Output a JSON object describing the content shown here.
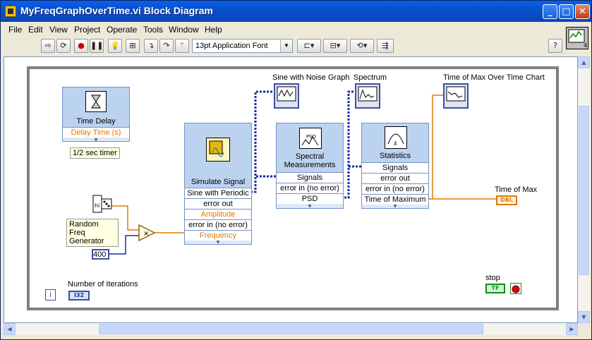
{
  "window": {
    "title": "MyFreqGraphOverTime.vi Block Diagram"
  },
  "menu": [
    "File",
    "Edit",
    "View",
    "Project",
    "Operate",
    "Tools",
    "Window",
    "Help"
  ],
  "toolbar": {
    "font": "13pt Application Font"
  },
  "nodes": {
    "time_delay": {
      "title": "Time Delay",
      "terminal": "Delay Time (s)",
      "comment": "1/2 sec timer"
    },
    "simulate_signal": {
      "title": "Simulate Signal",
      "terminals": [
        "Sine with Periodic",
        "error out",
        "Amplitude",
        "error in (no error)",
        "Frequency"
      ]
    },
    "spectral": {
      "title": "Spectral Measurements",
      "terminals": [
        "Signals",
        "error in (no error)",
        "PSD"
      ]
    },
    "statistics": {
      "title": "Statistics",
      "terminals": [
        "Signals",
        "error out",
        "error in (no error)",
        "Time of Maximum"
      ]
    }
  },
  "indicators": {
    "sine_graph": "Sine with Noise Graph",
    "spectrum": "Spectrum",
    "time_chart": "Time of Max Over Time Chart",
    "time_of_max": "Time of Max",
    "time_of_max_type": "DBL"
  },
  "random": {
    "label": "Random Freq Generator"
  },
  "multiplier_const": "400",
  "iteration": {
    "label": "Number of Iterations",
    "terminal": "i",
    "type": "I32"
  },
  "stop": {
    "label": "stop",
    "value": "TF"
  },
  "colors": {
    "wire_signal": "#1A2CA6",
    "wire_numeric": "#E07A00",
    "node_bg": "#DDE9F7"
  }
}
